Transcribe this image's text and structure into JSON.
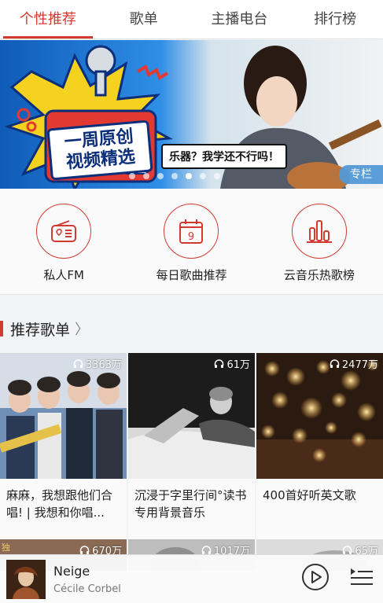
{
  "tabs": [
    {
      "label": "个性推荐",
      "active": true
    },
    {
      "label": "歌单",
      "active": false
    },
    {
      "label": "主播电台",
      "active": false
    },
    {
      "label": "排行榜",
      "active": false
    }
  ],
  "banner": {
    "headline_line1": "一周原创",
    "headline_line2": "视频精选",
    "bubble": "乐器？我学还不行吗！",
    "tag": "专栏",
    "dots_count": 7,
    "active_dot": 4
  },
  "features": [
    {
      "label": "私人FM",
      "icon": "radio-icon"
    },
    {
      "label": "每日歌曲推荐",
      "icon": "calendar-icon",
      "day": "9"
    },
    {
      "label": "云音乐热歌榜",
      "icon": "chart-icon"
    }
  ],
  "section": {
    "title": "推荐歌单",
    "arrow": "〉"
  },
  "playlists": [
    {
      "plays": "3363万",
      "title": "麻麻，我想跟他们合唱! | 我想和你唱..."
    },
    {
      "plays": "61万",
      "title": "沉浸于字里行间°读书专用背景音乐"
    },
    {
      "plays": "2477万",
      "title": "400首好听英文歌"
    }
  ],
  "playlists_row2": [
    {
      "plays": "670万",
      "badge": "独"
    },
    {
      "plays": "1017万"
    },
    {
      "plays": "65万"
    }
  ],
  "player": {
    "title": "Neige",
    "artist": "Cécile Corbel"
  },
  "colors": {
    "accent": "#d33a31"
  }
}
